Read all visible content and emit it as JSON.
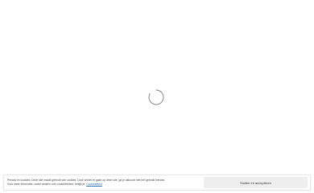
{
  "loader": {
    "icon": "loading-spinner-icon",
    "color": "#7a7a7a"
  },
  "cookie_notice": {
    "text_line1": "Privacy en cookies: Deze site maakt gebruik van cookies. Door verder te gaan op deze site, ga je akkoord met het gebruik hiervan.",
    "text_line2_prefix": "Voor meer informatie, onder andere over cookiebeheer, bekijk je:",
    "link_label": "Cookiebeleid",
    "link_color": "#2a6db5",
    "close_button_label": "Sluiten en accepteren"
  }
}
